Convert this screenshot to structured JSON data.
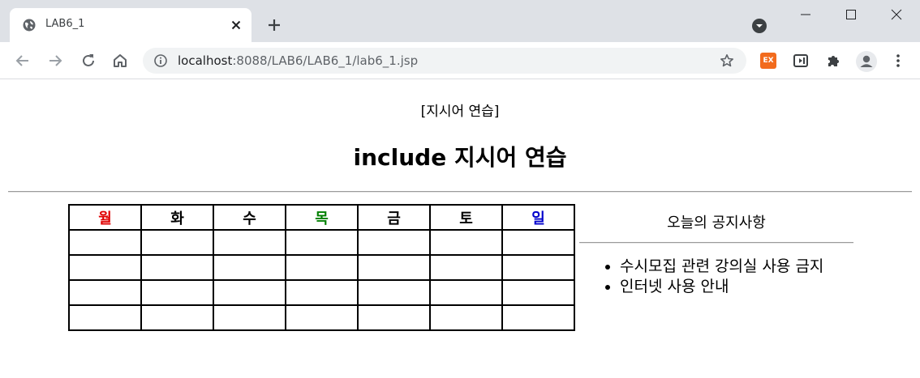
{
  "browser": {
    "tab_title": "LAB6_1",
    "url_host": "localhost",
    "url_path": ":8088/LAB6/LAB6_1/lab6_1.jsp",
    "extension_ex_label": "EX"
  },
  "page": {
    "directive_label": "[지시어 연습]",
    "title": "include 지시어 연습"
  },
  "calendar": {
    "days": [
      {
        "label": "월",
        "color": "#e00000"
      },
      {
        "label": "화",
        "color": "#000000"
      },
      {
        "label": "수",
        "color": "#000000"
      },
      {
        "label": "목",
        "color": "#008000"
      },
      {
        "label": "금",
        "color": "#000000"
      },
      {
        "label": "토",
        "color": "#000000"
      },
      {
        "label": "일",
        "color": "#0000cc"
      }
    ],
    "empty_rows": 4
  },
  "notice": {
    "title": "오늘의 공지사항",
    "items": [
      "수시모집 관련 강의실 사용 금지",
      "인터넷 사용 안내"
    ]
  }
}
